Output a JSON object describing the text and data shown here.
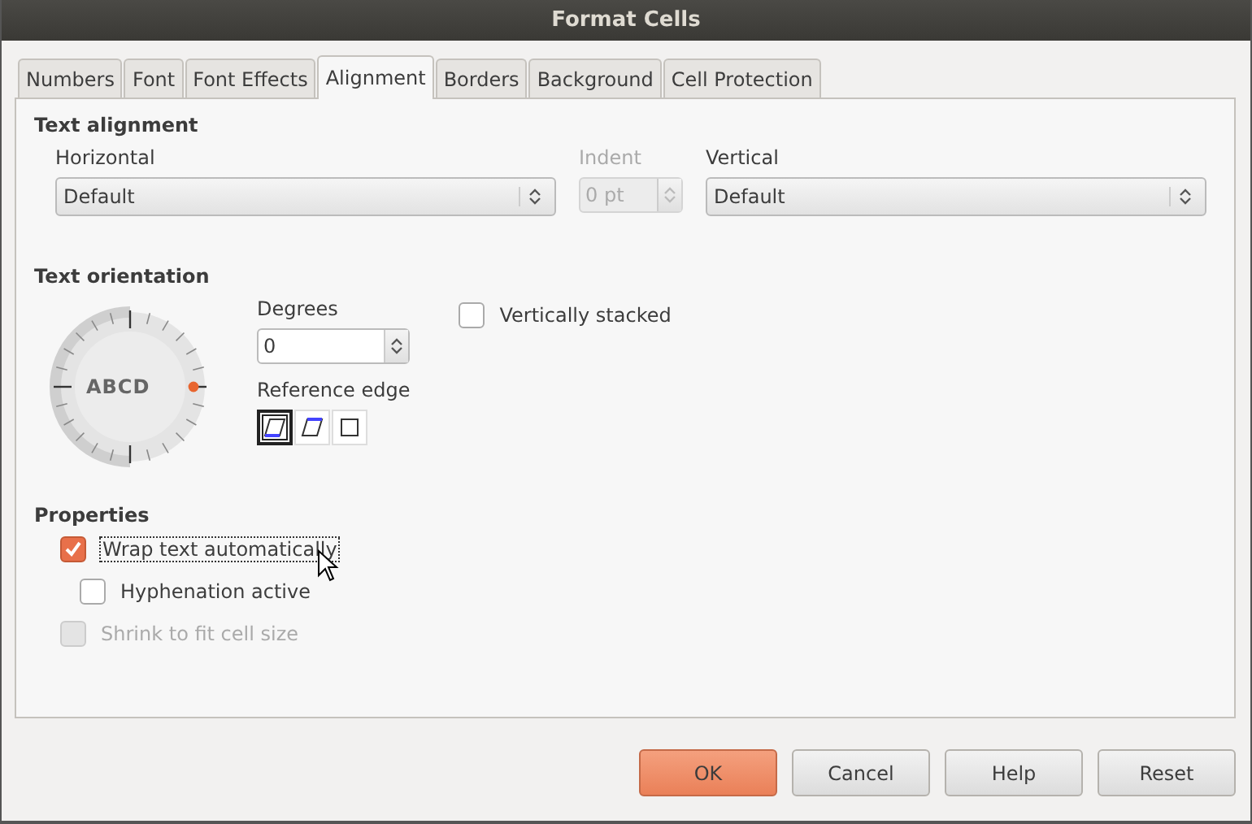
{
  "window": {
    "title": "Format Cells"
  },
  "tabs": [
    {
      "label": "Numbers",
      "selected": false
    },
    {
      "label": "Font",
      "selected": false
    },
    {
      "label": "Font Effects",
      "selected": false
    },
    {
      "label": "Alignment",
      "selected": true
    },
    {
      "label": "Borders",
      "selected": false
    },
    {
      "label": "Background",
      "selected": false
    },
    {
      "label": "Cell Protection",
      "selected": false
    }
  ],
  "text_alignment": {
    "heading": "Text alignment",
    "horizontal": {
      "label": "Horizontal",
      "value": "Default"
    },
    "indent": {
      "label": "Indent",
      "value": "0 pt",
      "disabled": true
    },
    "vertical": {
      "label": "Vertical",
      "value": "Default"
    }
  },
  "text_orientation": {
    "heading": "Text orientation",
    "dial_text": "ABCD",
    "degrees": {
      "label": "Degrees",
      "value": "0"
    },
    "reference_edge": {
      "label": "Reference edge",
      "options": [
        {
          "kind": "bottom",
          "selected": true
        },
        {
          "kind": "top",
          "selected": false
        },
        {
          "kind": "none",
          "selected": false
        }
      ]
    },
    "vertically_stacked": {
      "label": "Vertically stacked",
      "checked": false
    }
  },
  "properties": {
    "heading": "Properties",
    "options": [
      {
        "label": "Wrap text automatically",
        "checked": true,
        "focused": true,
        "disabled": false,
        "children": [
          {
            "label": "Hyphenation active",
            "checked": false,
            "focused": false,
            "disabled": false
          }
        ]
      },
      {
        "label": "Shrink to fit cell size",
        "checked": false,
        "focused": false,
        "disabled": true
      }
    ]
  },
  "buttons": [
    {
      "label": "OK",
      "default": true
    },
    {
      "label": "Cancel",
      "default": false
    },
    {
      "label": "Help",
      "default": false
    },
    {
      "label": "Reset",
      "default": false
    }
  ]
}
